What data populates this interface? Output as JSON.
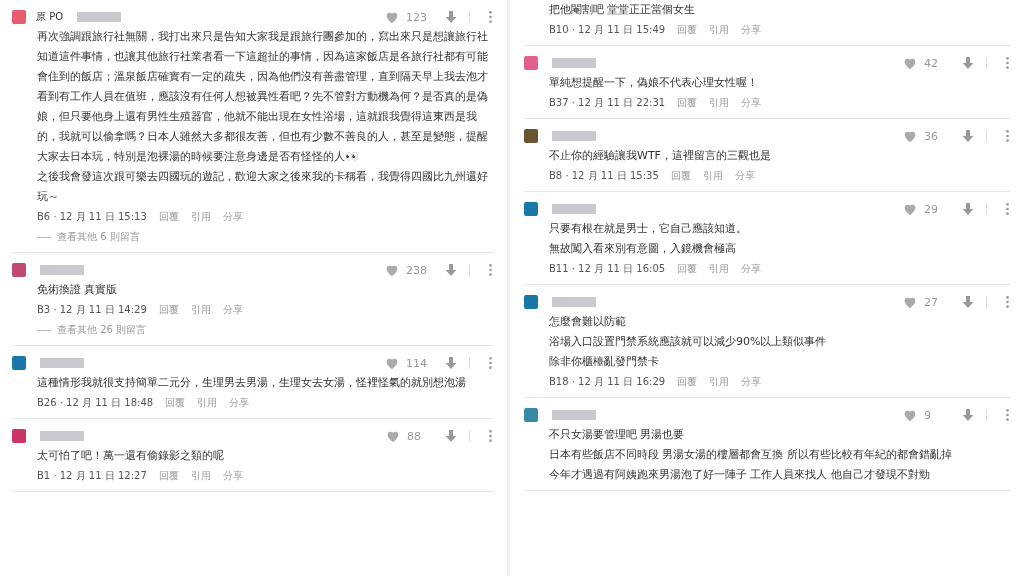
{
  "columns": [
    {
      "comments": [
        {
          "author": "原 PO",
          "color": "#e85a6e",
          "likes": "123",
          "body": [
            "再次強調跟旅行社無關，我打出來只是告知大家我是跟旅行團參加的，寫出來只是想讓旅行社知道這件事情，也讓其他旅行社業者看一下這超扯的事情，因為這家飯店是各旅行社都有可能會住到的飯店；溫泉飯店確實有一定的疏失，因為他們沒有善盡管理，直到隔天早上我去泡才看到有工作人員在值班，應該沒有任何人想被異性看吧？先不管對方動機為何？是否真的是偽娘，但只要他身上還有男性生殖器官，他就不能出現在女性浴場，這就跟我覺得這東西是我的，我就可以偷拿嗎？日本人雖然大多都很友善，但也有少數不善良的人，甚至是變態，提醒大家去日本玩，特別是泡裸湯的時候要注意身邊是否有怪怪的人👀",
            "之後我會發這次跟可樂去四國玩的遊記，歡迎大家之後來我的卡稱看，我覺得四國比九州還好玩～"
          ],
          "meta": "B6 · 12 月 11 日 15:13",
          "actions": [
            "回覆",
            "引用",
            "分享"
          ],
          "replies": "查看其他 6 則留言"
        },
        {
          "color": "#c04a70",
          "likes": "238",
          "body": [
            "免術換證 真實版"
          ],
          "meta": "B3 · 12 月 11 日 14:29",
          "actions": [
            "回覆",
            "引用",
            "分享"
          ],
          "replies": "查看其他 26 則留言"
        },
        {
          "color": "#1a78a8",
          "likes": "114",
          "body": [
            "這種情形我就很支持簡單二元分，生理男去男湯，生理女去女湯，怪裡怪氣的就別想泡湯"
          ],
          "meta": "B26 · 12 月 11 日 18:48",
          "actions": [
            "回覆",
            "引用",
            "分享"
          ]
        },
        {
          "color": "#cc3366",
          "likes": "88",
          "body": [
            "太可怕了吧！萬一還有偷錄影之類的呢"
          ],
          "meta": "B1 · 12 月 11 日 12:27",
          "actions": [
            "回覆",
            "引用",
            "分享"
          ]
        }
      ]
    },
    {
      "comments": [
        {
          "body": [
            "把他閹割吧 堂堂正正當個女生"
          ],
          "meta": "B10 · 12 月 11 日 15:49",
          "actions": [
            "回覆",
            "引用",
            "分享"
          ]
        },
        {
          "color": "#e0608a",
          "likes": "42",
          "body": [
            "單純想提醒一下，偽娘不代表心理女性喔！"
          ],
          "meta": "B37 · 12 月 11 日 22:31",
          "actions": [
            "回覆",
            "引用",
            "分享"
          ]
        },
        {
          "color": "#6b5530",
          "likes": "36",
          "body": [
            "不止你的經驗讓我WTF，這裡留言的三觀也是"
          ],
          "meta": "B8 · 12 月 11 日 15:35",
          "actions": [
            "回覆",
            "引用",
            "分享"
          ]
        },
        {
          "color": "#1a78a8",
          "likes": "29",
          "body": [
            "只要有根在就是男士，它自己應該知道。",
            "無故闖入看來別有意圖，入鏡機會極高"
          ],
          "meta": "B11 · 12 月 11 日 16:05",
          "actions": [
            "回覆",
            "引用",
            "分享"
          ]
        },
        {
          "color": "#1a78a8",
          "likes": "27",
          "body": [
            "怎麼會難以防範",
            "浴場入口設置門禁系統應該就可以減少90%以上類似事件",
            "除非你櫃檯亂發門禁卡"
          ],
          "meta": "B18 · 12 月 11 日 16:29",
          "actions": [
            "回覆",
            "引用",
            "分享"
          ]
        },
        {
          "color": "#3a88a8",
          "likes": "9",
          "body": [
            "不只女湯要管理吧 男湯也要",
            "日本有些飯店不同時段 男湯女湯的樓層都會互換 所以有些比較有年紀的都會錯亂掉",
            "今年才遇過有阿姨跑來男湯泡了好一陣子 工作人員來找人 他自己才發現不對勁"
          ]
        }
      ]
    }
  ]
}
